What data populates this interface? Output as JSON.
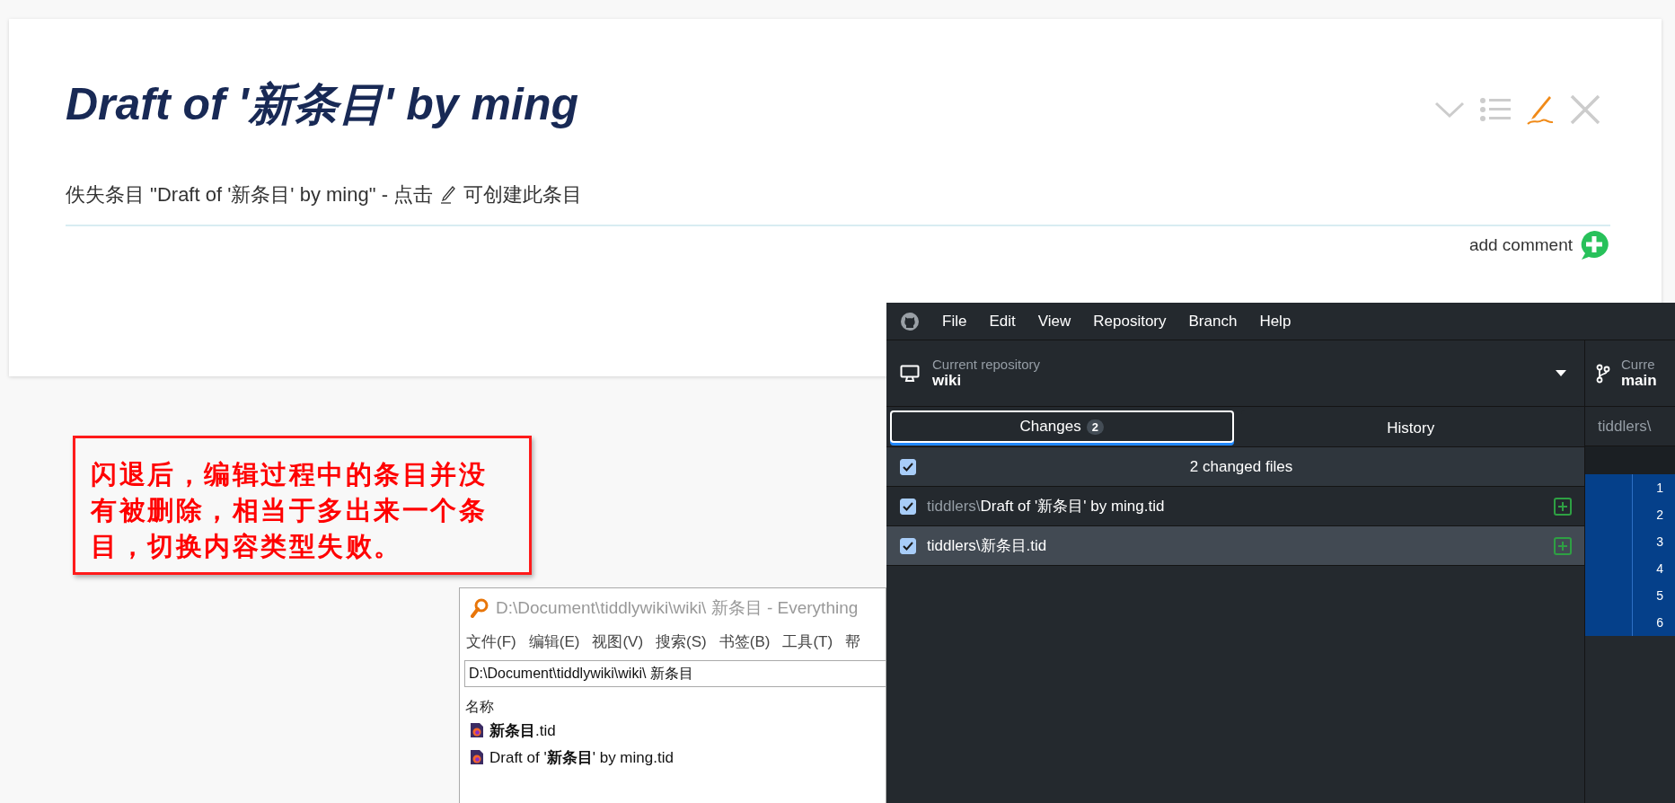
{
  "tiddler": {
    "title": "Draft of '新条目' by ming",
    "toolbar": [
      {
        "kind": "chevron"
      },
      {
        "kind": "list"
      },
      {
        "kind": "edit"
      },
      {
        "kind": "close"
      }
    ],
    "body": {
      "before": "佚失条目 \"Draft of '新条目' by ming\" - 点击",
      "after": "可创建此条目"
    },
    "add_comment": "add comment"
  },
  "annotation": {
    "text": "闪退后，编辑过程中的条目并没有被删除，相当于多出来一个条目，切换内容类型失败。"
  },
  "everything": {
    "title": "D:\\Document\\tiddlywiki\\wiki\\ 新条目 - Everything",
    "menu": [
      "文件(F)",
      "编辑(E)",
      "视图(V)",
      "搜索(S)",
      "书签(B)",
      "工具(T)",
      "帮"
    ],
    "search": "D:\\Document\\tiddlywiki\\wiki\\ 新条目",
    "column": "名称",
    "files": [
      "**新条目**.tid",
      "Draft of '**新条目**' by ming.tid"
    ]
  },
  "github": {
    "menu": [
      "File",
      "Edit",
      "View",
      "Repository",
      "Branch",
      "Help"
    ],
    "repository": {
      "label": "Current repository",
      "name": "wiki"
    },
    "branch": {
      "label": "Curre",
      "name": "main"
    },
    "tabs": [
      {
        "label": "Changes",
        "count": "2",
        "selected": true
      },
      {
        "label": "History",
        "selected": false
      }
    ],
    "changes_header": {
      "label": "2 changed files",
      "checked": true
    },
    "files": [
      {
        "folder": "tiddlers\\",
        "name": "Draft of '新条目' by ming.tid",
        "checked": true,
        "selected": false,
        "kind": "added"
      },
      {
        "folder": "tiddlers\\",
        "name": "新条目.tid",
        "checked": true,
        "selected": true,
        "kind": "added"
      }
    ],
    "diff_tab": "tiddlers\\",
    "diff_lines": [
      "1",
      "2",
      "3",
      "4",
      "5",
      "6"
    ]
  }
}
